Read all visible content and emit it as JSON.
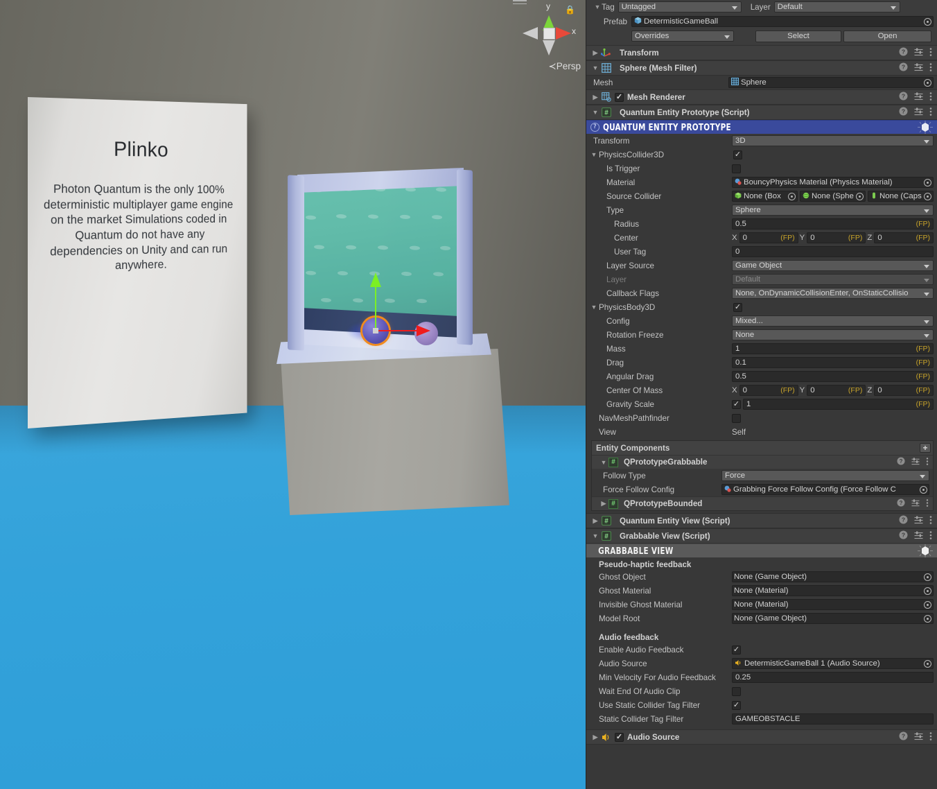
{
  "scene": {
    "sign": {
      "title": "Plinko",
      "body": "Photon Quantum is the only 100% deterministic multiplayer game engine on the market Simulations coded in Quantum do not have any dependencies on Unity and can run anywhere."
    },
    "gizmo": {
      "x_label": "x",
      "y_label": "y",
      "projection": "Persp",
      "projection_prefix": "≺"
    }
  },
  "inspector": {
    "tag": {
      "label": "Tag",
      "value": "Untagged"
    },
    "layer": {
      "label": "Layer",
      "value": "Default"
    },
    "prefab": {
      "label": "Prefab",
      "value": "DetermisticGameBall",
      "overrides_label": "Overrides",
      "select_label": "Select",
      "open_label": "Open"
    },
    "components": [
      {
        "name": "Transform"
      },
      {
        "name": "Sphere (Mesh Filter)"
      },
      {
        "name": "Mesh Renderer"
      },
      {
        "name": "Quantum Entity Prototype (Script)"
      },
      {
        "name": "Quantum Entity View (Script)"
      },
      {
        "name": "Grabbable View (Script)"
      },
      {
        "name": "Audio Source"
      }
    ],
    "mesh_filter": {
      "mesh_label": "Mesh",
      "mesh_value": "Sphere"
    },
    "quantum_banner": "QUANTUM ENTITY PROTOTYPE",
    "quantum": {
      "transform": {
        "label": "Transform",
        "value": "3D"
      },
      "collider_group": "PhysicsCollider3D",
      "is_trigger": {
        "label": "Is Trigger",
        "checked": false
      },
      "material": {
        "label": "Material",
        "value": "BouncyPhysics Material (Physics Material)"
      },
      "source_collider": {
        "label": "Source Collider",
        "box": "None (Box ",
        "sphere": "None (Sphe",
        "capsule": "None (Caps"
      },
      "type": {
        "label": "Type",
        "value": "Sphere"
      },
      "radius": {
        "label": "Radius",
        "value": "0.5",
        "unit": "(FP)"
      },
      "center": {
        "label": "Center",
        "x": "0",
        "y": "0",
        "z": "0",
        "unit": "(FP)"
      },
      "user_tag": {
        "label": "User Tag",
        "value": "0"
      },
      "layer_source": {
        "label": "Layer Source",
        "value": "Game Object"
      },
      "layer": {
        "label": "Layer",
        "value": "Default"
      },
      "callback_flags": {
        "label": "Callback Flags",
        "value": "None, OnDynamicCollisionEnter, OnStaticCollisio"
      },
      "body_group": "PhysicsBody3D",
      "config": {
        "label": "Config",
        "value": "Mixed..."
      },
      "rotation_freeze": {
        "label": "Rotation Freeze",
        "value": "None"
      },
      "mass": {
        "label": "Mass",
        "value": "1",
        "unit": "(FP)"
      },
      "drag": {
        "label": "Drag",
        "value": "0.1",
        "unit": "(FP)"
      },
      "angular_drag": {
        "label": "Angular Drag",
        "value": "0.5",
        "unit": "(FP)"
      },
      "center_of_mass": {
        "label": "Center Of Mass",
        "x": "0",
        "y": "0",
        "z": "0",
        "unit": "(FP)"
      },
      "gravity_scale": {
        "label": "Gravity Scale",
        "value": "1",
        "unit": "(FP)",
        "checked": true
      },
      "navmesh_pathfinder": {
        "label": "NavMeshPathfinder",
        "checked": false
      },
      "view": {
        "label": "View",
        "value": "Self"
      }
    },
    "entity_components": {
      "title": "Entity Components",
      "add_label": "+",
      "grabbable": {
        "name": "QPrototypeGrabbable",
        "follow_type": {
          "label": "Follow Type",
          "value": "Force"
        },
        "force_follow_config": {
          "label": "Force Follow Config",
          "value": "Grabbing Force Follow Config (Force Follow C"
        }
      },
      "bounded": {
        "name": "QPrototypeBounded"
      }
    },
    "grabbable_banner": "GRABBABLE VIEW",
    "grabbable_view": {
      "haptic_title": "Pseudo-haptic feedback",
      "ghost_object": {
        "label": "Ghost Object",
        "value": "None (Game Object)"
      },
      "ghost_material": {
        "label": "Ghost Material",
        "value": "None (Material)"
      },
      "invisible_ghost_material": {
        "label": "Invisible Ghost Material",
        "value": "None (Material)"
      },
      "model_root": {
        "label": "Model Root",
        "value": "None (Game Object)"
      },
      "audio_title": "Audio feedback",
      "enable_audio_feedback": {
        "label": "Enable Audio Feedback",
        "checked": true
      },
      "audio_source": {
        "label": "Audio Source",
        "value": "DetermisticGameBall 1 (Audio Source)"
      },
      "min_velocity": {
        "label": "Min Velocity For Audio Feedback",
        "value": "0.25"
      },
      "wait_end_clip": {
        "label": "Wait End Of Audio Clip",
        "checked": false
      },
      "use_tag_filter": {
        "label": "Use Static Collider Tag Filter",
        "checked": true
      },
      "tag_filter": {
        "label": "Static Collider Tag Filter",
        "value": "GAMEOBSTACLE"
      }
    },
    "audio_source_component": {
      "name": "Audio Source",
      "checked": true
    }
  },
  "colors": {
    "quantum_banner": "#3a4a9c",
    "panel_bg": "#383838",
    "field_bg": "#2a2a2a",
    "fp_unit": "#c8a42a",
    "floor": "#33a2da",
    "selection_outline": "#f08a1e"
  }
}
